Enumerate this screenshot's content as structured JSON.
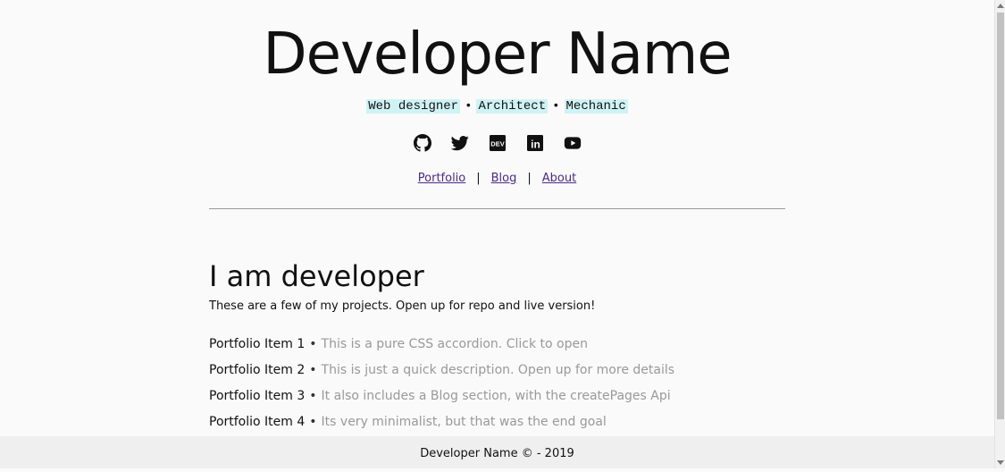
{
  "header": {
    "title": "Developer Name",
    "roles": [
      "Web designer",
      "Architect",
      "Mechanic"
    ],
    "role_separator": "•"
  },
  "socials": [
    {
      "icon": "github-icon"
    },
    {
      "icon": "twitter-icon"
    },
    {
      "icon": "dev-icon",
      "text": "DEV"
    },
    {
      "icon": "linkedin-icon",
      "text": "in"
    },
    {
      "icon": "youtube-icon"
    }
  ],
  "nav": {
    "portfolio": "Portfolio",
    "blog": "Blog",
    "about": "About",
    "separator": "|"
  },
  "main": {
    "title": "I am developer",
    "intro": "These are a few of my projects. Open up for repo and live version!",
    "item_separator": "•",
    "items": [
      {
        "name": "Portfolio Item 1",
        "desc": "This is a pure CSS accordion. Click to open"
      },
      {
        "name": "Portfolio Item 2",
        "desc": "This is just a quick description. Open up for more details"
      },
      {
        "name": "Portfolio Item 3",
        "desc": "It also includes a Blog section, with the createPages Api"
      },
      {
        "name": "Portfolio Item 4",
        "desc": "Its very minimalist, but that was the end goal"
      }
    ]
  },
  "footer": {
    "text": "Developer Name © - 2019"
  },
  "colors": {
    "background": "#fafafa",
    "role_highlight": "#cff2f5",
    "link": "#4b2a85",
    "muted": "#999999",
    "footer_bg": "#efefef"
  }
}
